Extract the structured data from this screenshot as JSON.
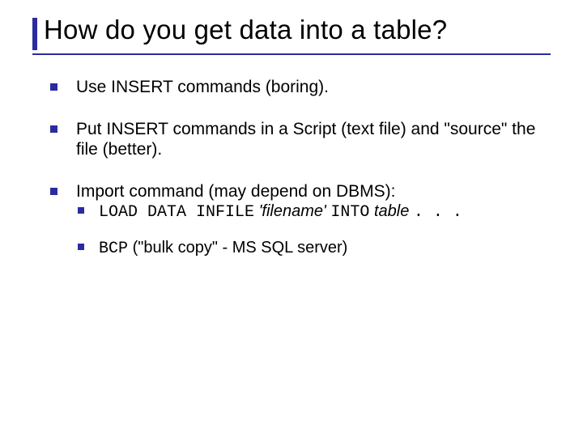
{
  "title": "How do you get data into a table?",
  "bullets": [
    {
      "text": "Use INSERT commands (boring)."
    },
    {
      "text": "Put INSERT commands in a Script (text file) and \"source\" the file (better)."
    },
    {
      "text": "Import command (may depend on DBMS):"
    }
  ],
  "sub_bullets": [
    {
      "parts": {
        "code1": "LOAD DATA INFILE",
        "ital1": "'filename'",
        "code2": "INTO",
        "ital2": "table",
        "code3": ". . ."
      }
    },
    {
      "parts": {
        "code1": "BCP",
        "rest": " (\"bulk copy\" - MS SQL server)"
      }
    }
  ],
  "colors": {
    "accent": "#2b2ba0"
  }
}
